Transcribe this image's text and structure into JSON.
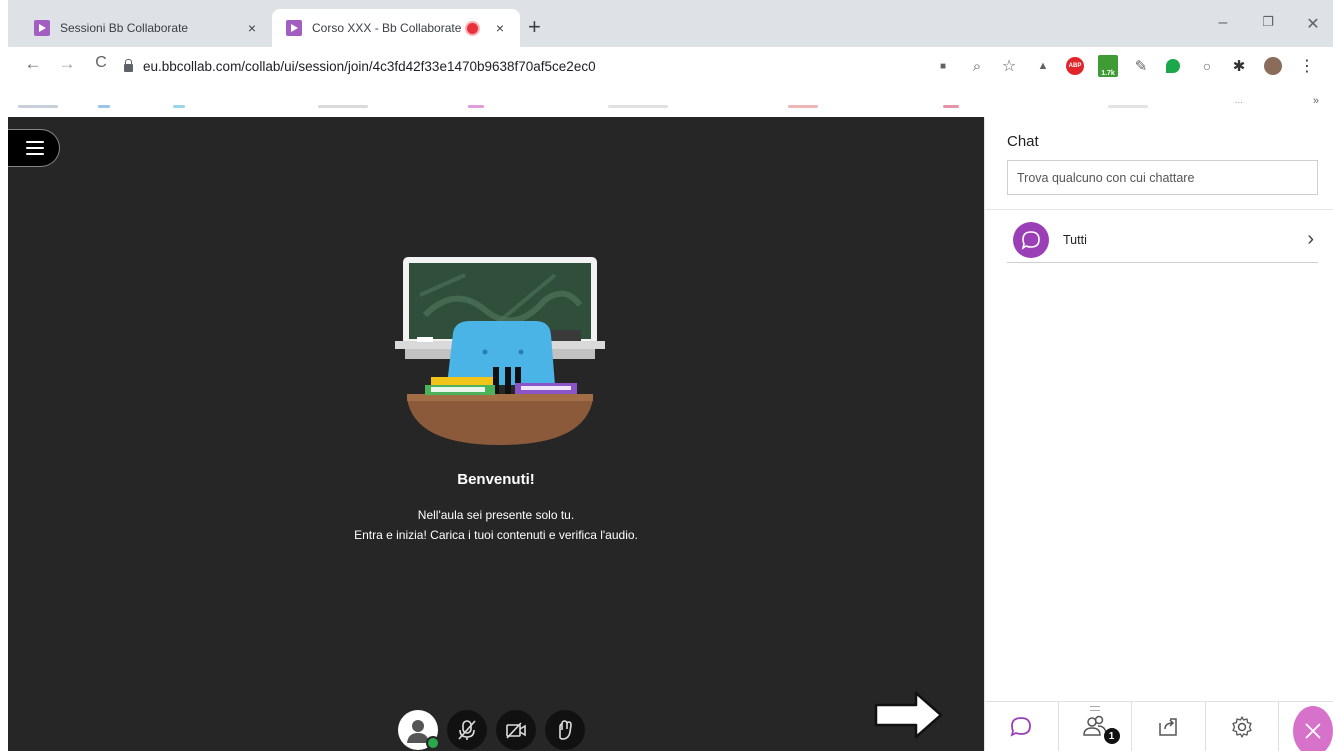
{
  "browser": {
    "tabs": [
      {
        "title": "Sessioni Bb Collaborate",
        "close": "×"
      },
      {
        "title": "Corso XXX - Bb Collaborate",
        "close": "×"
      }
    ],
    "new_tab": "+",
    "window_controls": {
      "minimize": "–",
      "restore": "❐",
      "close": "✕"
    },
    "url": "eu.bbcollab.com/collab/ui/session/join/4c3fd42f33e1470b9638f70af5ce2ec0",
    "nav": {
      "back": "←",
      "forward": "→",
      "reload": "C"
    },
    "extensions": [
      {
        "name": "camera-icon",
        "glyph": "■"
      },
      {
        "name": "zoom-icon",
        "glyph": "⌕"
      },
      {
        "name": "star-icon",
        "glyph": "☆"
      },
      {
        "name": "drive-icon",
        "glyph": "▲"
      },
      {
        "name": "adblock-icon",
        "glyph": "ABP"
      },
      {
        "name": "counter-extension-icon",
        "glyph": "1.7k"
      },
      {
        "name": "puzzle-pen-icon",
        "glyph": "✎"
      },
      {
        "name": "leaf-icon",
        "glyph": ""
      },
      {
        "name": "ring-icon",
        "glyph": "○"
      },
      {
        "name": "extensions-icon",
        "glyph": "✱"
      },
      {
        "name": "profile-avatar-icon",
        "glyph": ""
      },
      {
        "name": "kebab-menu-icon",
        "glyph": "⋮"
      }
    ],
    "bookmarks_more": "»",
    "bookmarks_overflow": "..."
  },
  "stage": {
    "welcome_title": "Benvenuti!",
    "welcome_line1": "Nell'aula sei presente solo tu.",
    "welcome_line2": "Entra e inizia! Carica i tuoi contenuti e verifica l'audio."
  },
  "panel": {
    "title": "Chat",
    "search_placeholder": "Trova qualcuno con cui chattare",
    "chat_item": "Tutti",
    "attendees_count": "1"
  },
  "colors": {
    "stage_bg": "#262626",
    "chat_accent": "#9b3fb6",
    "close_accent": "#d672c9",
    "recording": "#e8303a"
  }
}
